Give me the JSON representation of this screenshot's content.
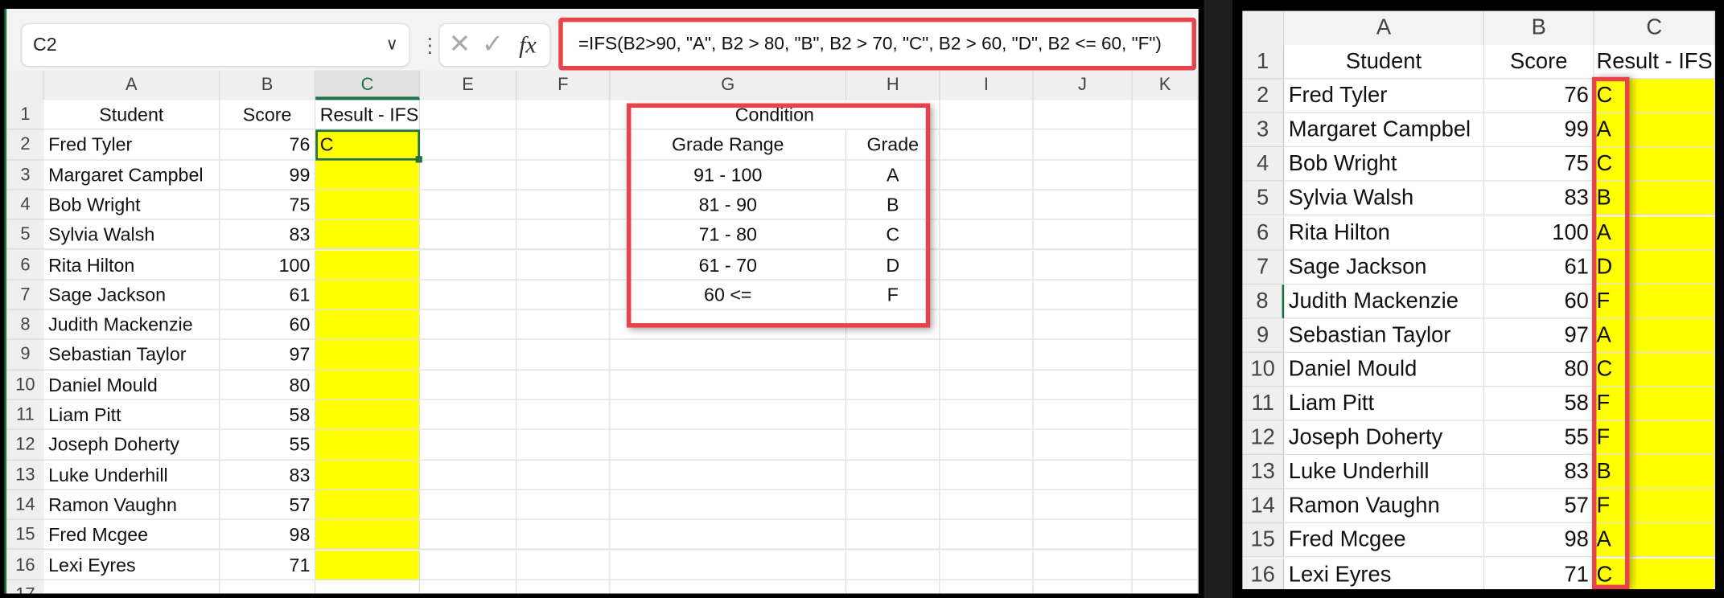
{
  "left": {
    "name_box": "C2",
    "formula": "=IFS(B2>90, \"A\", B2 > 80, \"B\", B2 > 70, \"C\", B2 > 60, \"D\", B2 <= 60, \"F\")",
    "columns": [
      "A",
      "B",
      "C",
      "E",
      "F",
      "G",
      "H",
      "I",
      "J",
      "K"
    ],
    "headers": {
      "student": "Student",
      "score": "Score",
      "result": "Result - IFS"
    },
    "c2_value": "C",
    "condition": {
      "title": "Condition",
      "col1": "Grade Range",
      "col2": "Grade",
      "rows": [
        {
          "range": "91 - 100",
          "grade": "A"
        },
        {
          "range": "81 - 90",
          "grade": "B"
        },
        {
          "range": "71 - 80",
          "grade": "C"
        },
        {
          "range": "61 - 70",
          "grade": "D"
        },
        {
          "range": "60 <=",
          "grade": "F"
        }
      ]
    },
    "last_row_partial": "17"
  },
  "right": {
    "columns": [
      "A",
      "B",
      "C"
    ],
    "headers": {
      "student": "Student",
      "score": "Score",
      "result": "Result - IFS"
    }
  },
  "students": [
    {
      "name": "Fred Tyler",
      "score": "76",
      "grade": "C"
    },
    {
      "name": "Margaret Campbel",
      "score": "99",
      "grade": "A"
    },
    {
      "name": "Bob Wright",
      "score": "75",
      "grade": "C"
    },
    {
      "name": "Sylvia Walsh",
      "score": "83",
      "grade": "B"
    },
    {
      "name": "Rita Hilton",
      "score": "100",
      "grade": "A"
    },
    {
      "name": "Sage Jackson",
      "score": "61",
      "grade": "D"
    },
    {
      "name": "Judith Mackenzie",
      "score": "60",
      "grade": "F"
    },
    {
      "name": "Sebastian Taylor",
      "score": "97",
      "grade": "A"
    },
    {
      "name": "Daniel Mould",
      "score": "80",
      "grade": "C"
    },
    {
      "name": "Liam Pitt",
      "score": "58",
      "grade": "F"
    },
    {
      "name": "Joseph Doherty",
      "score": "55",
      "grade": "F"
    },
    {
      "name": "Luke Underhill",
      "score": "83",
      "grade": "B"
    },
    {
      "name": "Ramon Vaughn",
      "score": "57",
      "grade": "F"
    },
    {
      "name": "Fred Mcgee",
      "score": "98",
      "grade": "A"
    },
    {
      "name": "Lexi Eyres",
      "score": "71",
      "grade": "C"
    }
  ],
  "colors": {
    "highlight": "#ffff00",
    "annotation": "#e8424a",
    "selection": "#1e7145"
  }
}
